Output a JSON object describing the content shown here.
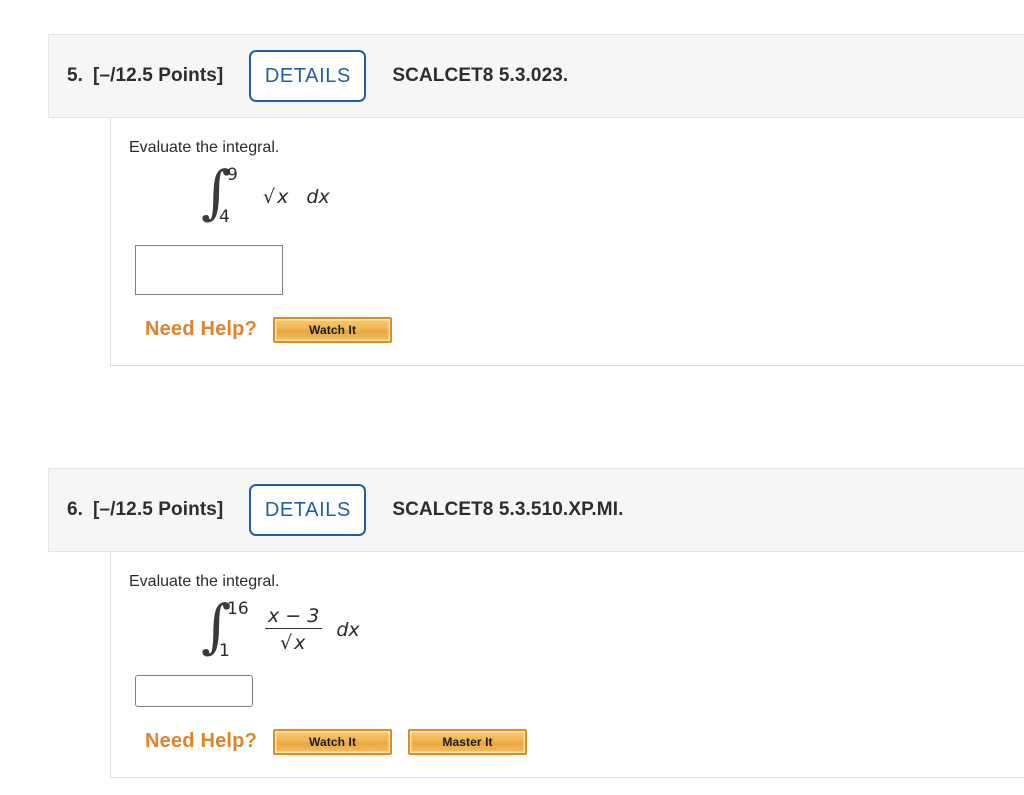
{
  "page": {
    "background_color": "#ffffff",
    "accent_blue": "#215e9e",
    "accent_orange": "#e0842a",
    "header_bg": "#f6f6f6"
  },
  "problems": [
    {
      "number": "5.",
      "points": "[–/12.5 Points]",
      "details_label": "DETAILS",
      "code": "SCALCET8 5.3.023.",
      "prompt": "Evaluate the integral.",
      "math": {
        "integral_symbol": "∫",
        "upper_limit": "9",
        "lower_limit": "4",
        "integrand_type": "sqrt",
        "radicand": "x",
        "sqrt_symbol": "√",
        "differential": "dx"
      },
      "answer_value": "",
      "answer_placeholder": "",
      "help_label": "Need Help?",
      "help_buttons": [
        {
          "label": "Watch It",
          "name": "watch-it-button"
        }
      ]
    },
    {
      "number": "6.",
      "points": "[–/12.5 Points]",
      "details_label": "DETAILS",
      "code": "SCALCET8 5.3.510.XP.MI.",
      "prompt": "Evaluate the integral.",
      "math": {
        "integral_symbol": "∫",
        "upper_limit": "16",
        "lower_limit": "1",
        "integrand_type": "fraction",
        "numerator": "x − 3",
        "denominator_sqrt_symbol": "√",
        "denominator_radicand": "x",
        "differential": "dx"
      },
      "answer_value": "",
      "answer_placeholder": "",
      "help_label": "Need Help?",
      "help_buttons": [
        {
          "label": "Watch It",
          "name": "watch-it-button"
        },
        {
          "label": "Master It",
          "name": "master-it-button"
        }
      ]
    }
  ]
}
